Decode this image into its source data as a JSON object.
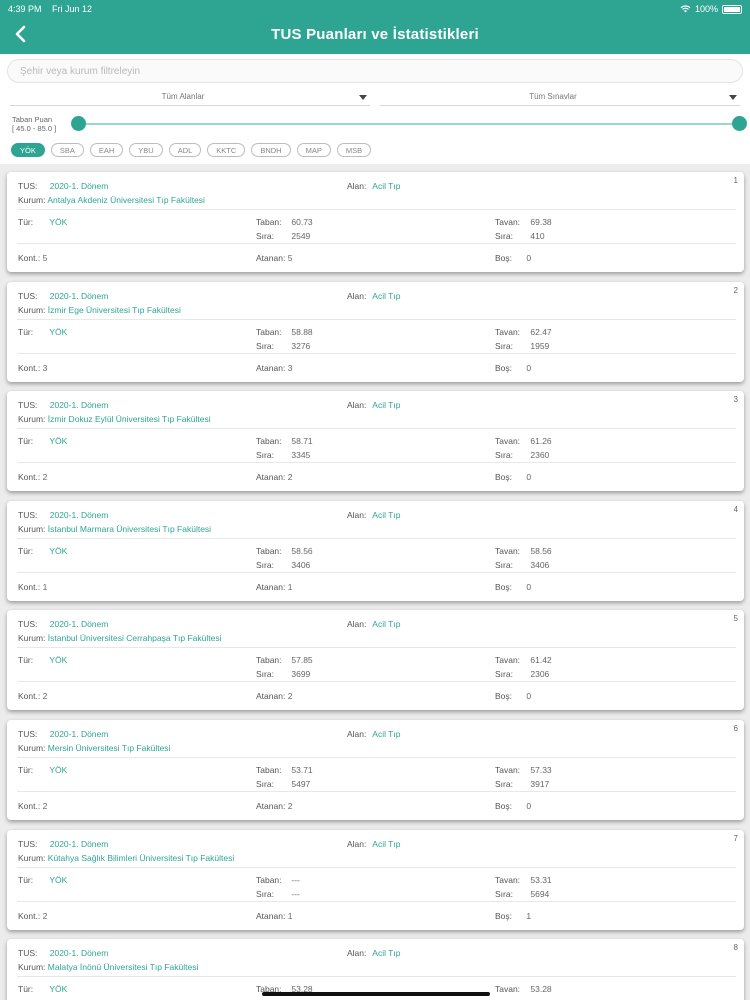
{
  "status_bar": {
    "time": "4:39 PM",
    "date": "Fri Jun 12",
    "battery": "100%"
  },
  "header": {
    "title": "TUS Puanları ve İstatistikleri"
  },
  "filters": {
    "search_placeholder": "Şehir veya kurum filtreleyin",
    "field_select": "Tüm Alanlar",
    "exam_select": "Tüm Sınavlar",
    "range_label": "Taban Puan",
    "range_value": "[ 45.0 - 85.0 ]",
    "chips": [
      "YÖK",
      "SBA",
      "EAH",
      "YBU",
      "ADL",
      "KKTC",
      "BNDH",
      "MAP",
      "MSB"
    ],
    "active_chip": "YÖK"
  },
  "labels": {
    "tus": "TUS:",
    "alan": "Alan:",
    "kurum": "Kurum:",
    "tur": "Tür:",
    "taban": "Taban:",
    "tavan": "Tavan:",
    "sira": "Sıra:",
    "kont": "Kont.:",
    "atanan": "Atanan:",
    "bos": "Boş:"
  },
  "results": [
    {
      "index": "1",
      "term": "2020-1. Dönem",
      "field": "Acil Tıp",
      "institution": "Antalya Akdeniz Üniversitesi Tıp Fakültesi",
      "type": "YÖK",
      "taban": "60.73",
      "taban_sira": "2549",
      "tavan": "69.38",
      "tavan_sira": "410",
      "kont": "5",
      "atanan": "5",
      "bos": "0"
    },
    {
      "index": "2",
      "term": "2020-1. Dönem",
      "field": "Acil Tıp",
      "institution": "İzmir Ege Üniversitesi Tıp Fakültesi",
      "type": "YÖK",
      "taban": "58.88",
      "taban_sira": "3276",
      "tavan": "62.47",
      "tavan_sira": "1959",
      "kont": "3",
      "atanan": "3",
      "bos": "0"
    },
    {
      "index": "3",
      "term": "2020-1. Dönem",
      "field": "Acil Tıp",
      "institution": "İzmir Dokuz Eylül Üniversitesi Tıp Fakültesi",
      "type": "YÖK",
      "taban": "58.71",
      "taban_sira": "3345",
      "tavan": "61.26",
      "tavan_sira": "2360",
      "kont": "2",
      "atanan": "2",
      "bos": "0"
    },
    {
      "index": "4",
      "term": "2020-1. Dönem",
      "field": "Acil Tıp",
      "institution": "İstanbul Marmara Üniversitesi Tıp Fakültesi",
      "type": "YÖK",
      "taban": "58.56",
      "taban_sira": "3406",
      "tavan": "58.56",
      "tavan_sira": "3406",
      "kont": "1",
      "atanan": "1",
      "bos": "0"
    },
    {
      "index": "5",
      "term": "2020-1. Dönem",
      "field": "Acil Tıp",
      "institution": "İstanbul Üniversitesi Cerrahpaşa Tıp Fakültesi",
      "type": "YÖK",
      "taban": "57.85",
      "taban_sira": "3699",
      "tavan": "61.42",
      "tavan_sira": "2306",
      "kont": "2",
      "atanan": "2",
      "bos": "0"
    },
    {
      "index": "6",
      "term": "2020-1. Dönem",
      "field": "Acil Tıp",
      "institution": "Mersin Üniversitesi Tıp Fakültesi",
      "type": "YÖK",
      "taban": "53.71",
      "taban_sira": "5497",
      "tavan": "57.33",
      "tavan_sira": "3917",
      "kont": "2",
      "atanan": "2",
      "bos": "0"
    },
    {
      "index": "7",
      "term": "2020-1. Dönem",
      "field": "Acil Tıp",
      "institution": "Kütahya Sağlık Bilimleri Üniversitesi Tıp Fakültesi",
      "type": "YÖK",
      "taban": "---",
      "taban_sira": "---",
      "tavan": "53.31",
      "tavan_sira": "5694",
      "kont": "2",
      "atanan": "1",
      "bos": "1"
    },
    {
      "index": "8",
      "term": "2020-1. Dönem",
      "field": "Acil Tıp",
      "institution": "Malatya İnönü Üniversitesi Tıp Fakültesi",
      "type": "YÖK",
      "taban": "53.28",
      "taban_sira": "",
      "tavan": "53.28",
      "tavan_sira": "",
      "kont": "",
      "atanan": "",
      "bos": ""
    }
  ]
}
